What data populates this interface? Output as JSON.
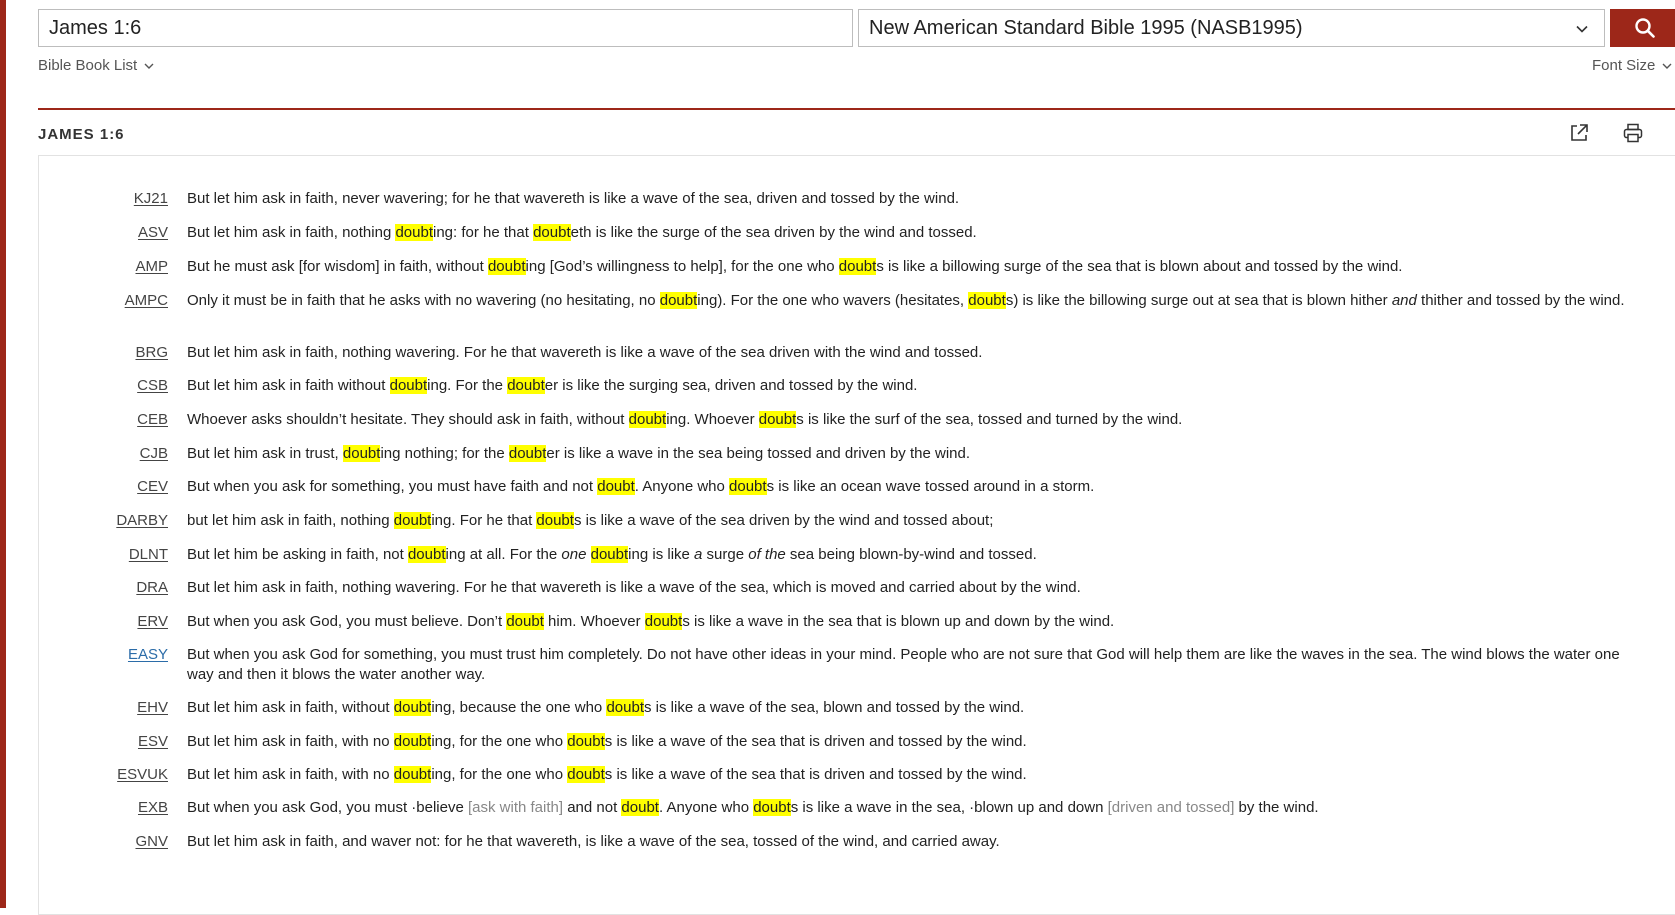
{
  "search": {
    "value": "James 1:6"
  },
  "version_select": {
    "selected": "New American Standard Bible 1995 (NASB1995)"
  },
  "nav": {
    "book_list": "Bible Book List",
    "font_size": "Font Size"
  },
  "passage": {
    "title": "JAMES 1:6"
  },
  "colors": {
    "accent": "#9d2719",
    "highlight": "#ffff00",
    "link": "#2b6ca8"
  },
  "verses": [
    {
      "abbr": "KJ21",
      "segments": [
        {
          "t": "But let him ask in faith, never wavering; for he that wavereth is like a wave of the sea, driven and tossed by the wind."
        }
      ]
    },
    {
      "abbr": "ASV",
      "segments": [
        {
          "t": "But let him ask in faith, nothing "
        },
        {
          "t": "doubt",
          "s": "hl"
        },
        {
          "t": "ing: for he that "
        },
        {
          "t": "doubt",
          "s": "hl"
        },
        {
          "t": "eth is like the surge of the sea driven by the wind and tossed."
        }
      ]
    },
    {
      "abbr": "AMP",
      "segments": [
        {
          "t": "But he must ask [for wisdom] in faith, without "
        },
        {
          "t": "doubt",
          "s": "hl"
        },
        {
          "t": "ing [God’s willingness to help], for the one who "
        },
        {
          "t": "doubt",
          "s": "hl"
        },
        {
          "t": "s is like a billowing surge of the sea that is blown about and tossed by the wind."
        }
      ]
    },
    {
      "abbr": "AMPC",
      "segments": [
        {
          "t": "Only it must be in faith that he asks with no wavering (no hesitating, no "
        },
        {
          "t": "doubt",
          "s": "hl"
        },
        {
          "t": "ing). For the one who wavers (hesitates, "
        },
        {
          "t": "doubt",
          "s": "hl"
        },
        {
          "t": "s) is like the billowing surge out at sea that is blown hither "
        },
        {
          "t": "and",
          "s": "it"
        },
        {
          "t": " thither and tossed by the wind."
        }
      ]
    },
    {
      "abbr": "BRG",
      "segments": [
        {
          "t": "But let him ask in faith, nothing wavering. For he that wavereth is like a wave of the sea driven with the wind and tossed."
        }
      ]
    },
    {
      "abbr": "CSB",
      "segments": [
        {
          "t": "But let him ask in faith without "
        },
        {
          "t": "doubt",
          "s": "hl"
        },
        {
          "t": "ing. For the "
        },
        {
          "t": "doubt",
          "s": "hl"
        },
        {
          "t": "er is like the surging sea, driven and tossed by the wind."
        }
      ]
    },
    {
      "abbr": "CEB",
      "segments": [
        {
          "t": "Whoever asks shouldn’t hesitate. They should ask in faith, without "
        },
        {
          "t": "doubt",
          "s": "hl"
        },
        {
          "t": "ing. Whoever "
        },
        {
          "t": "doubt",
          "s": "hl"
        },
        {
          "t": "s is like the surf of the sea, tossed and turned by the wind."
        }
      ]
    },
    {
      "abbr": "CJB",
      "segments": [
        {
          "t": "But let him ask in trust, "
        },
        {
          "t": "doubt",
          "s": "hl"
        },
        {
          "t": "ing nothing; for the "
        },
        {
          "t": "doubt",
          "s": "hl"
        },
        {
          "t": "er is like a wave in the sea being tossed and driven by the wind."
        }
      ]
    },
    {
      "abbr": "CEV",
      "segments": [
        {
          "t": "But when you ask for something, you must have faith and not "
        },
        {
          "t": "doubt",
          "s": "hl"
        },
        {
          "t": ". Anyone who "
        },
        {
          "t": "doubt",
          "s": "hl"
        },
        {
          "t": "s is like an ocean wave tossed around in a storm."
        }
      ]
    },
    {
      "abbr": "DARBY",
      "segments": [
        {
          "t": "but let him ask in faith, nothing "
        },
        {
          "t": "doubt",
          "s": "hl"
        },
        {
          "t": "ing. For he that "
        },
        {
          "t": "doubt",
          "s": "hl"
        },
        {
          "t": "s is like a wave of the sea driven by the wind and tossed about;"
        }
      ]
    },
    {
      "abbr": "DLNT",
      "segments": [
        {
          "t": "But let him be asking in faith, not "
        },
        {
          "t": "doubt",
          "s": "hl"
        },
        {
          "t": "ing at all. For the "
        },
        {
          "t": "one",
          "s": "it"
        },
        {
          "t": " "
        },
        {
          "t": "doubt",
          "s": "hl"
        },
        {
          "t": "ing is like "
        },
        {
          "t": "a",
          "s": "it"
        },
        {
          "t": " surge "
        },
        {
          "t": "of the",
          "s": "it"
        },
        {
          "t": " sea being blown-by-wind and tossed."
        }
      ]
    },
    {
      "abbr": "DRA",
      "segments": [
        {
          "t": "But let him ask in faith, nothing wavering. For he that wavereth is like a wave of the sea, which is moved and carried about by the wind."
        }
      ]
    },
    {
      "abbr": "ERV",
      "segments": [
        {
          "t": "But when you ask God, you must believe. Don’t "
        },
        {
          "t": "doubt",
          "s": "hl"
        },
        {
          "t": " him. Whoever "
        },
        {
          "t": "doubt",
          "s": "hl"
        },
        {
          "t": "s is like a wave in the sea that is blown up and down by the wind."
        }
      ]
    },
    {
      "abbr": "EASY",
      "link": true,
      "segments": [
        {
          "t": "But when you ask God for something, you must trust him completely. Do not have other ideas in your mind. People who are not sure that God will help them are like the waves in the sea. The wind blows the water one way and then it blows the water another way."
        }
      ]
    },
    {
      "abbr": "EHV",
      "segments": [
        {
          "t": "But let him ask in faith, without "
        },
        {
          "t": "doubt",
          "s": "hl"
        },
        {
          "t": "ing, because the one who "
        },
        {
          "t": "doubt",
          "s": "hl"
        },
        {
          "t": "s is like a wave of the sea, blown and tossed by the wind."
        }
      ]
    },
    {
      "abbr": "ESV",
      "segments": [
        {
          "t": "But let him ask in faith, with no "
        },
        {
          "t": "doubt",
          "s": "hl"
        },
        {
          "t": "ing, for the one who "
        },
        {
          "t": "doubt",
          "s": "hl"
        },
        {
          "t": "s is like a wave of the sea that is driven and tossed by the wind."
        }
      ]
    },
    {
      "abbr": "ESVUK",
      "segments": [
        {
          "t": "But let him ask in faith, with no "
        },
        {
          "t": "doubt",
          "s": "hl"
        },
        {
          "t": "ing, for the one who "
        },
        {
          "t": "doubt",
          "s": "hl"
        },
        {
          "t": "s is like a wave of the sea that is driven and tossed by the wind."
        }
      ]
    },
    {
      "abbr": "EXB",
      "segments": [
        {
          "t": "But when you ask God, you must ·believe "
        },
        {
          "t": "[ask with faith]",
          "s": "gray"
        },
        {
          "t": " and not "
        },
        {
          "t": "doubt",
          "s": "hl"
        },
        {
          "t": ". Anyone who "
        },
        {
          "t": "doubt",
          "s": "hl"
        },
        {
          "t": "s is like a wave in the sea, ·blown up and down "
        },
        {
          "t": "[driven and tossed]",
          "s": "gray"
        },
        {
          "t": " by the wind."
        }
      ]
    },
    {
      "abbr": "GNV",
      "segments": [
        {
          "t": "But let him ask in faith, and waver not: for he that wavereth, is like a wave of the sea, tossed of the wind, and carried away."
        }
      ]
    }
  ]
}
